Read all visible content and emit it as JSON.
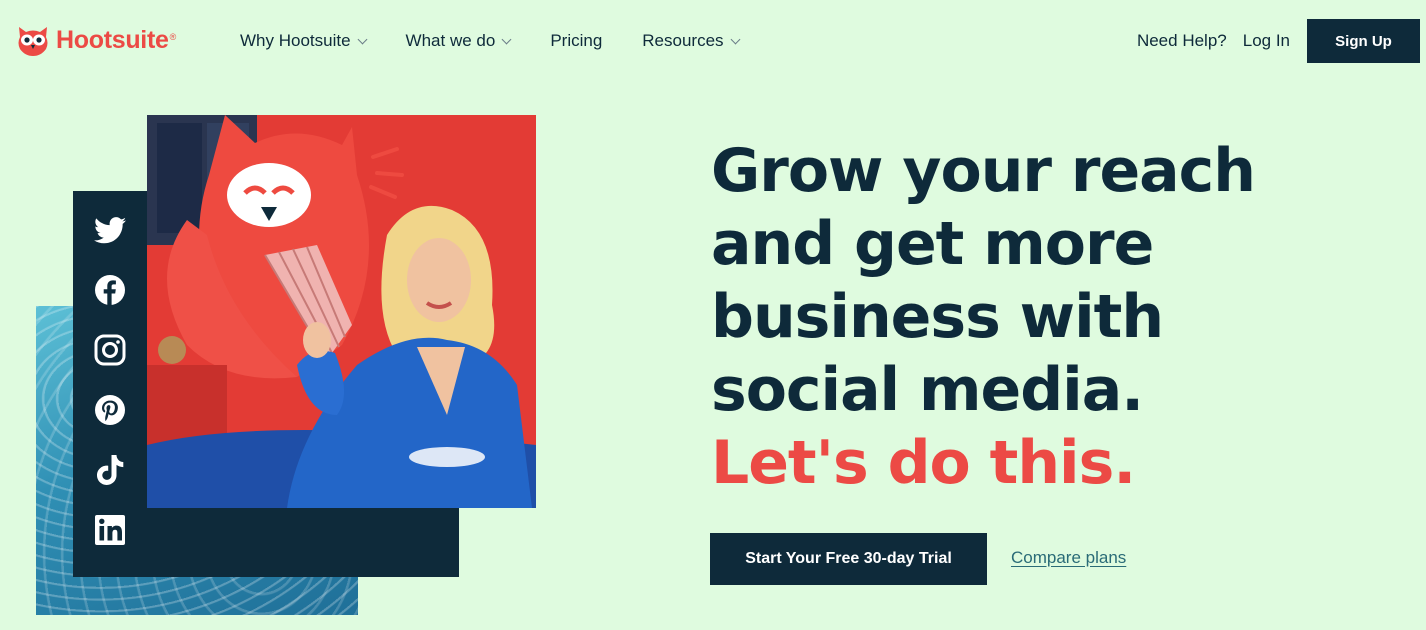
{
  "header": {
    "brand": "Hootsuite",
    "brand_mark": "®",
    "nav": [
      {
        "label": "Why Hootsuite",
        "dropdown": true
      },
      {
        "label": "What we do",
        "dropdown": true
      },
      {
        "label": "Pricing",
        "dropdown": false
      },
      {
        "label": "Resources",
        "dropdown": true
      }
    ],
    "help_label": "Need Help?",
    "login_label": "Log In",
    "signup_label": "Sign Up"
  },
  "social_icons": [
    "twitter-icon",
    "facebook-icon",
    "instagram-icon",
    "pinterest-icon",
    "tiktok-icon",
    "linkedin-icon"
  ],
  "hero": {
    "headline_lines": [
      "Grow your reach",
      "and get more",
      "business with",
      "social media."
    ],
    "accent_line": "Let's do this.",
    "cta_label": "Start Your Free 30-day Trial",
    "compare_label": "Compare plans"
  },
  "colors": {
    "background": "#dffbdf",
    "navy": "#0e2a3a",
    "brand_red": "#ec4a45",
    "link_teal": "#2a6b77"
  }
}
